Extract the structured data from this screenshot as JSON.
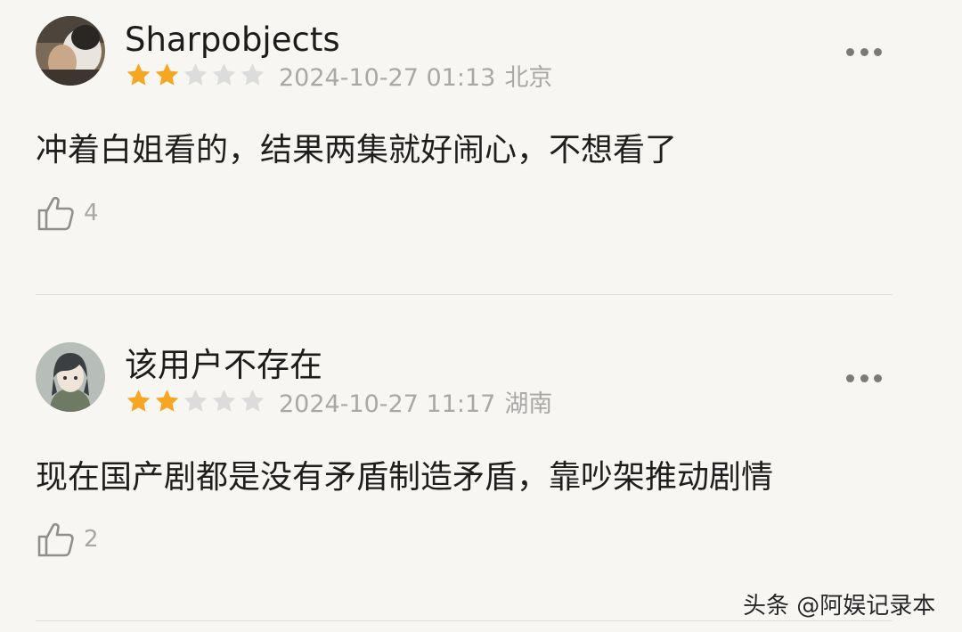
{
  "comments": [
    {
      "username": "Sharpobjects",
      "rating": 2,
      "rating_max": 5,
      "datetime": "2024-10-27 01:13",
      "location": "北京",
      "text": "冲着白姐看的，结果两集就好闹心，不想看了",
      "likes": "4",
      "avatar": "avatar-photo"
    },
    {
      "username": "该用户不存在",
      "rating": 2,
      "rating_max": 5,
      "datetime": "2024-10-27 11:17",
      "location": "湖南",
      "text": "现在国产剧都是没有矛盾制造矛盾，靠吵架推动剧情",
      "likes": "2",
      "avatar": "avatar-anime-character"
    }
  ],
  "icons": {
    "star": "star-icon",
    "more": "more-icon",
    "like": "thumbs-up-icon"
  },
  "colors": {
    "background": "#f8f6f3",
    "star_filled": "#f5a623",
    "star_empty": "#dcdcdc",
    "meta_text": "#a8a8a8"
  },
  "watermark": "头条 @阿娱记录本"
}
